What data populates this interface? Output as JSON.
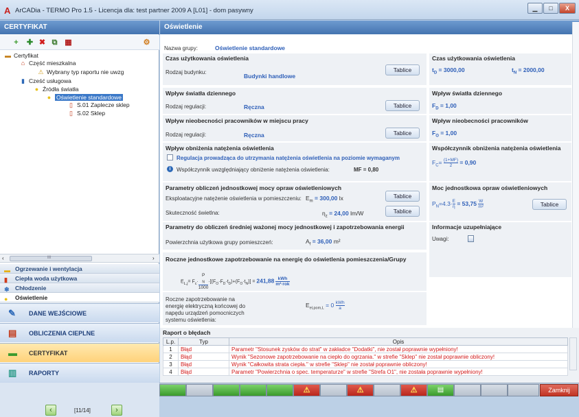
{
  "window": {
    "title": "ArCADia - TERMO Pro 1.5 - Licencja dla: test partner 2009 A [L01] - dom pasywny",
    "min": "▁",
    "max": "□",
    "close": "X"
  },
  "left": {
    "header": "CERTYFIKAT",
    "tree": [
      {
        "label": "Certyfikat",
        "icon": "certificate-icon"
      },
      {
        "label": "Część mieszkalna",
        "icon": "house-icon"
      },
      {
        "label": "Wybrany typ raportu nie uwzg",
        "icon": "warning-icon"
      },
      {
        "label": "Cześć usługowa",
        "icon": "building-icon"
      },
      {
        "label": "Źródła światła",
        "icon": "bulb-icon"
      },
      {
        "label": "Oświetlenie standardowe",
        "icon": "bulb-icon"
      },
      {
        "label": "S.01 Zaplecze sklep",
        "icon": "room-icon"
      },
      {
        "label": "S.02 Sklep",
        "icon": "room-icon"
      }
    ],
    "hscroll_mid": "III",
    "subnav": [
      "Ogrzewanie i wentylacja",
      "Ciepła woda użytkowa",
      "Chłodzenie",
      "Oświetlenie"
    ],
    "mainnav": [
      "DANE WEJŚCIOWE",
      "OBLICZENIA CIEPLNE",
      "CERTYFIKAT",
      "RAPORTY"
    ],
    "page": "[11/14]"
  },
  "main": {
    "header": "Oświetlenie",
    "group_label": "Nazwa grupy:",
    "group_value": "Oświetlenie standardowe",
    "s1": {
      "title": "Czas użytkowania oświetlenia",
      "label": "Rodzaj budynku:",
      "value": "Budynki handlowe",
      "btn": "Tablice",
      "rtitle": "Czas użytkowania oświetlenia",
      "td": "t",
      "td_sub": "D",
      "td_val": " = 3000,00",
      "tn": "t",
      "tn_sub": "N",
      "tn_val": " = 2000,00"
    },
    "s2": {
      "title": "Wpływ światła dziennego",
      "label": "Rodzaj regulacji:",
      "value": "Ręczna",
      "btn": "Tablice",
      "rtitle": "Wpływ światła dziennego",
      "f": "F",
      "f_sub": "D",
      "f_val": " = 1,00"
    },
    "s3": {
      "title": "Wpływ nieobecności pracowników w miejscu pracy",
      "label": "Rodzaj regulacji:",
      "value": "Ręczna",
      "btn": "Tablice",
      "rtitle": "Wpływ nieobecności pracowników",
      "f": "F",
      "f_sub": "O",
      "f_val": " = 1,00"
    },
    "s4": {
      "title": "Wpływ obniżenia natężenia oświetlenia",
      "checkbox": "Regulacja prowadząca do utrzymania natężenia oświetlenia na poziomie wymaganym",
      "note": "Współczynnik uwzględniający obniżenie natężenia oświetlenia:",
      "mf": "MF = 0,80",
      "rtitle": "Współczynnik obniżenia natężenia oświetlenia",
      "fc": "F",
      "fc_sub": "C",
      "fc_eq": "=",
      "fc_num": "(1+MF)",
      "fc_den": "2",
      "fc_val": "= 0,90"
    },
    "s5": {
      "title": "Parametry obliczeń jednostkowej mocy opraw oświetleniowych",
      "l1": "Eksploatacyjne natężenie oświetlenia w pomieszczeniu:",
      "e": "E",
      "e_sub": "m",
      "e_val": " = 300,00",
      "e_unit": "lx",
      "btn1": "Tablice",
      "l2": "Skuteczność świetlna:",
      "n": "η",
      "n_sub": "z",
      "n_val": " = 24,00",
      "n_unit": "lm/W",
      "btn2": "Tablice",
      "rtitle": "Moc jednostkowa opraw oświetleniowych",
      "pn": "P",
      "pn_sub": "N",
      "pn_eq": "=4.3·",
      "pn_num": "E",
      "pn_den": "η",
      "pn_val": "= 53,75",
      "pn_unum": "W",
      "pn_uden": "m²",
      "rbtn": "Tablice"
    },
    "s6": {
      "title": "Parametry do obliczeń średniej ważonej mocy jednostkowej i zapotrzebowania energii",
      "label": "Powierzchnia użytkowa grupy pomieszczeń:",
      "a": "A",
      "a_sub": "f",
      "a_val": " = 36,00",
      "a_unit": "m²",
      "rtitle": "Informacje uzupełniające",
      "uwagi": "Uwagi:"
    },
    "s7": {
      "title": "Roczne jednostkowe zapotrzebowanie na energię do oświetlenia pomieszczenia/Grupy",
      "formula_l": "E",
      "formula_sub": "L,j",
      "formula_mid": "= F",
      "formula_c": "c",
      "formula_frac_n": "P",
      "formula_frac_n_sub": "N",
      "formula_frac_d": "1000",
      "formula_rest": "·[(F",
      "formula_rest2": "·F",
      "formula_rest3": "·t",
      "formula_rest4": ")+(F",
      "formula_rest5": "·t",
      "formula_rest6": ")] =",
      "formula_val": "241,88",
      "formula_un": "kWh",
      "formula_ud": "m²·rok"
    },
    "s8": {
      "text": "Roczne zapotrzebowanie na energię elektryczną końcowej do napędu urządzeń pomocniczych systemu oświetlenia:",
      "e": "E",
      "e_sub": "el,pom,L",
      "e_val": " = 0",
      "un": "kWh",
      "ud": "a"
    },
    "errors": {
      "title": "Raport o błędach",
      "h_lp": "L.p.",
      "h_typ": "Typ",
      "h_opis": "Opis",
      "rows": [
        {
          "n": "1",
          "t": "Błąd",
          "d": "Parametr \"Stosunek zysków do strat\" w zakładce \"Dodatki\", nie został poprawnie wypełniony!"
        },
        {
          "n": "2",
          "t": "Błąd",
          "d": "Wynik \"Sezonowe zapotrzebowanie na ciepło do ogrzania.\" w strefie \"Sklep\" nie został poprawnie obliczony!"
        },
        {
          "n": "3",
          "t": "Błąd",
          "d": "Wynik \"Całkowita strata ciepła.\" w strefie \"Sklep\" nie został poprawnie obliczony!"
        },
        {
          "n": "4",
          "t": "Błąd",
          "d": "Parametr \"Powierzchnia o spec. temperaturze\" w strefie \"Strefa O1\", nie została poprawnie wypełniony!"
        }
      ]
    }
  },
  "status": {
    "close": "Zamknij"
  }
}
